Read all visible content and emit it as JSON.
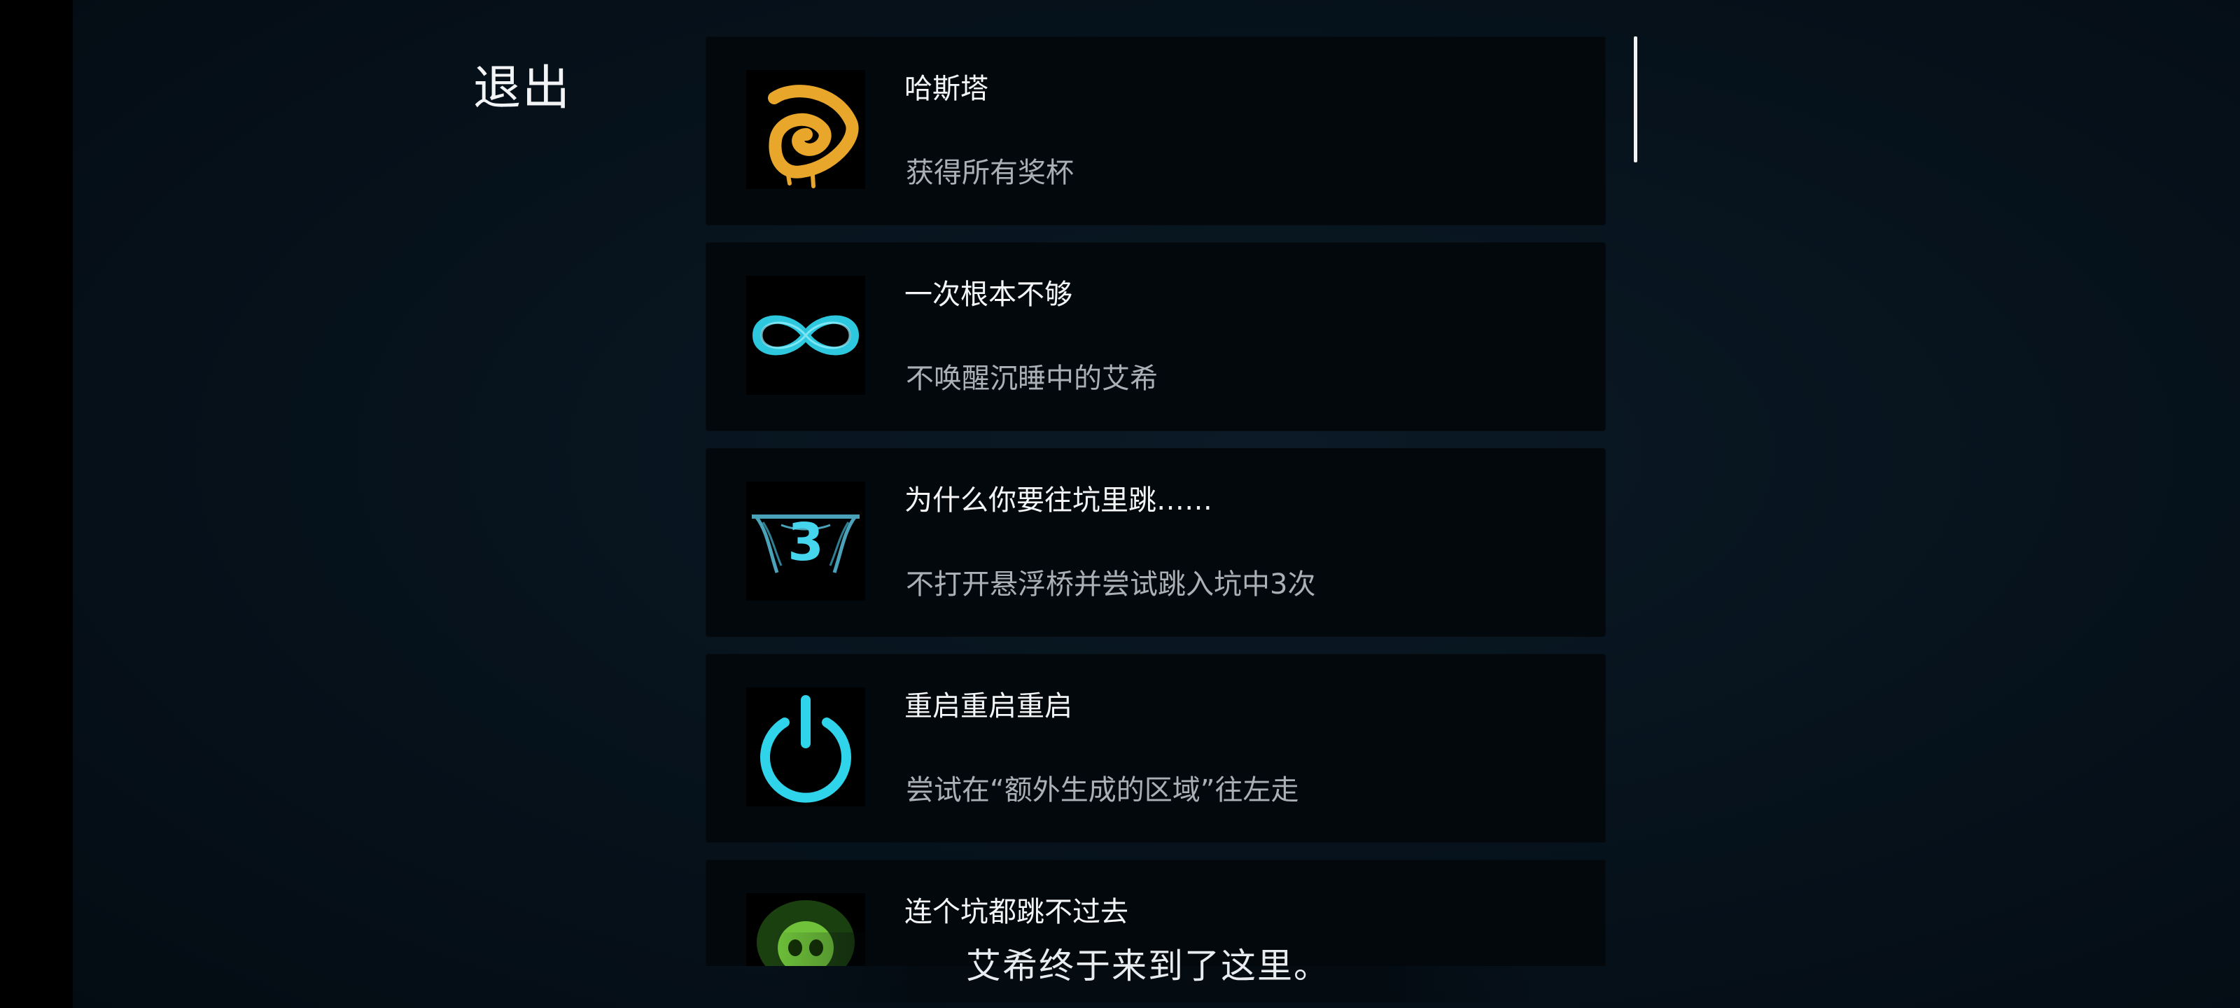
{
  "menu": {
    "exit_label": "退出"
  },
  "achievements": [
    {
      "title": "哈斯塔",
      "description": "获得所有奖杯",
      "icon": "hastur-sigil-icon"
    },
    {
      "title": "一次根本不够",
      "description": "不唤醒沉睡中的艾希",
      "icon": "infinity-icon"
    },
    {
      "title": "为什么你要往坑里跳……",
      "description": "不打开悬浮桥并尝试跳入坑中3次",
      "icon": "pit-three-icon",
      "icon_text": "3"
    },
    {
      "title": "重启重启重启",
      "description": "尝试在“额外生成的区域”往左走",
      "icon": "power-icon"
    },
    {
      "title": "连个坑都跳不过去",
      "description": "",
      "icon": "green-skull-icon"
    }
  ],
  "subtitle": "艾希终于来到了这里。",
  "colors": {
    "background": "#07131d",
    "card": "#03080d",
    "cyan_accent": "#2fd3ea",
    "gold_accent": "#e8a62a",
    "green_accent": "#6fc23a"
  }
}
